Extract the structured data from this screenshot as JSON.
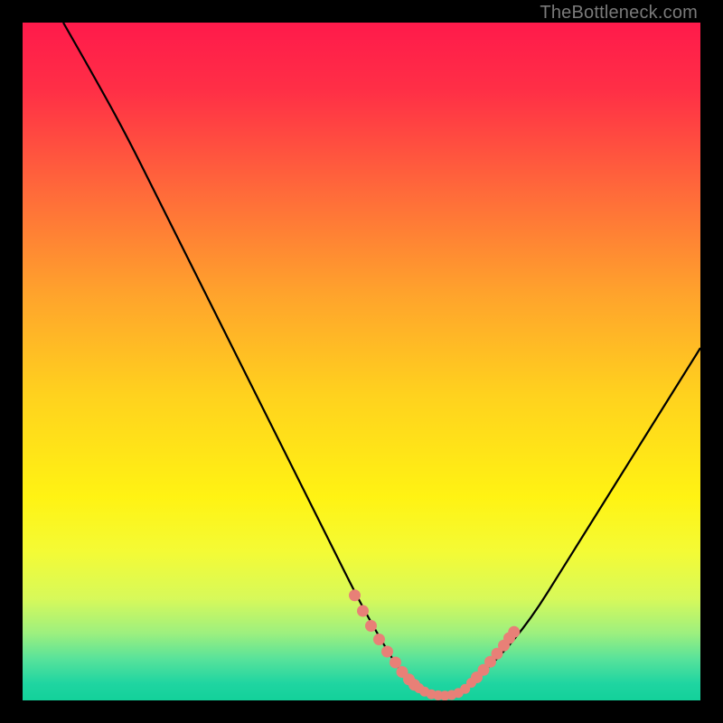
{
  "watermark": "TheBottleneck.com",
  "chart_data": {
    "type": "line",
    "title": "",
    "xlabel": "",
    "ylabel": "",
    "xlim": [
      0,
      100
    ],
    "ylim": [
      0,
      100
    ],
    "series": [
      {
        "name": "curve",
        "x": [
          6,
          10,
          15,
          20,
          25,
          30,
          35,
          40,
          45,
          50,
          54,
          56,
          58,
          60,
          62,
          64,
          66,
          70,
          75,
          80,
          85,
          90,
          95,
          100
        ],
        "values": [
          100,
          93,
          84,
          74,
          64,
          54,
          44,
          34,
          24,
          14,
          7,
          4,
          2,
          1,
          0.7,
          1,
          2.5,
          6,
          12,
          20,
          28,
          36,
          44,
          52
        ]
      },
      {
        "name": "highlight-left",
        "x": [
          49,
          50.2,
          51.4,
          52.6,
          53.8,
          55,
          56,
          57,
          57.8
        ],
        "values": [
          15.5,
          13.2,
          11,
          9,
          7.2,
          5.6,
          4.2,
          3.1,
          2.3
        ]
      },
      {
        "name": "highlight-right",
        "x": [
          67,
          68,
          69,
          70,
          71,
          71.8,
          72.5
        ],
        "values": [
          3.4,
          4.5,
          5.7,
          6.9,
          8.1,
          9.2,
          10.1
        ]
      },
      {
        "name": "highlight-bottom",
        "x": [
          58.5,
          59.3,
          60.3,
          61.3,
          62.3,
          63.3,
          64.3,
          65.3,
          66.2
        ],
        "values": [
          1.8,
          1.3,
          0.9,
          0.75,
          0.7,
          0.8,
          1.1,
          1.7,
          2.6
        ]
      }
    ],
    "gradient_stops": [
      {
        "offset": 0.0,
        "color": "#ff1a4b"
      },
      {
        "offset": 0.1,
        "color": "#ff2f46"
      },
      {
        "offset": 0.25,
        "color": "#ff6a3a"
      },
      {
        "offset": 0.4,
        "color": "#ffa32c"
      },
      {
        "offset": 0.55,
        "color": "#ffd21e"
      },
      {
        "offset": 0.7,
        "color": "#fff313"
      },
      {
        "offset": 0.78,
        "color": "#f4fb35"
      },
      {
        "offset": 0.85,
        "color": "#d7f95a"
      },
      {
        "offset": 0.9,
        "color": "#9ef07e"
      },
      {
        "offset": 0.94,
        "color": "#56e29b"
      },
      {
        "offset": 0.975,
        "color": "#1fd5a1"
      },
      {
        "offset": 1.0,
        "color": "#13d19a"
      }
    ],
    "marker_color": "#e88077",
    "curve_color": "#000000"
  }
}
